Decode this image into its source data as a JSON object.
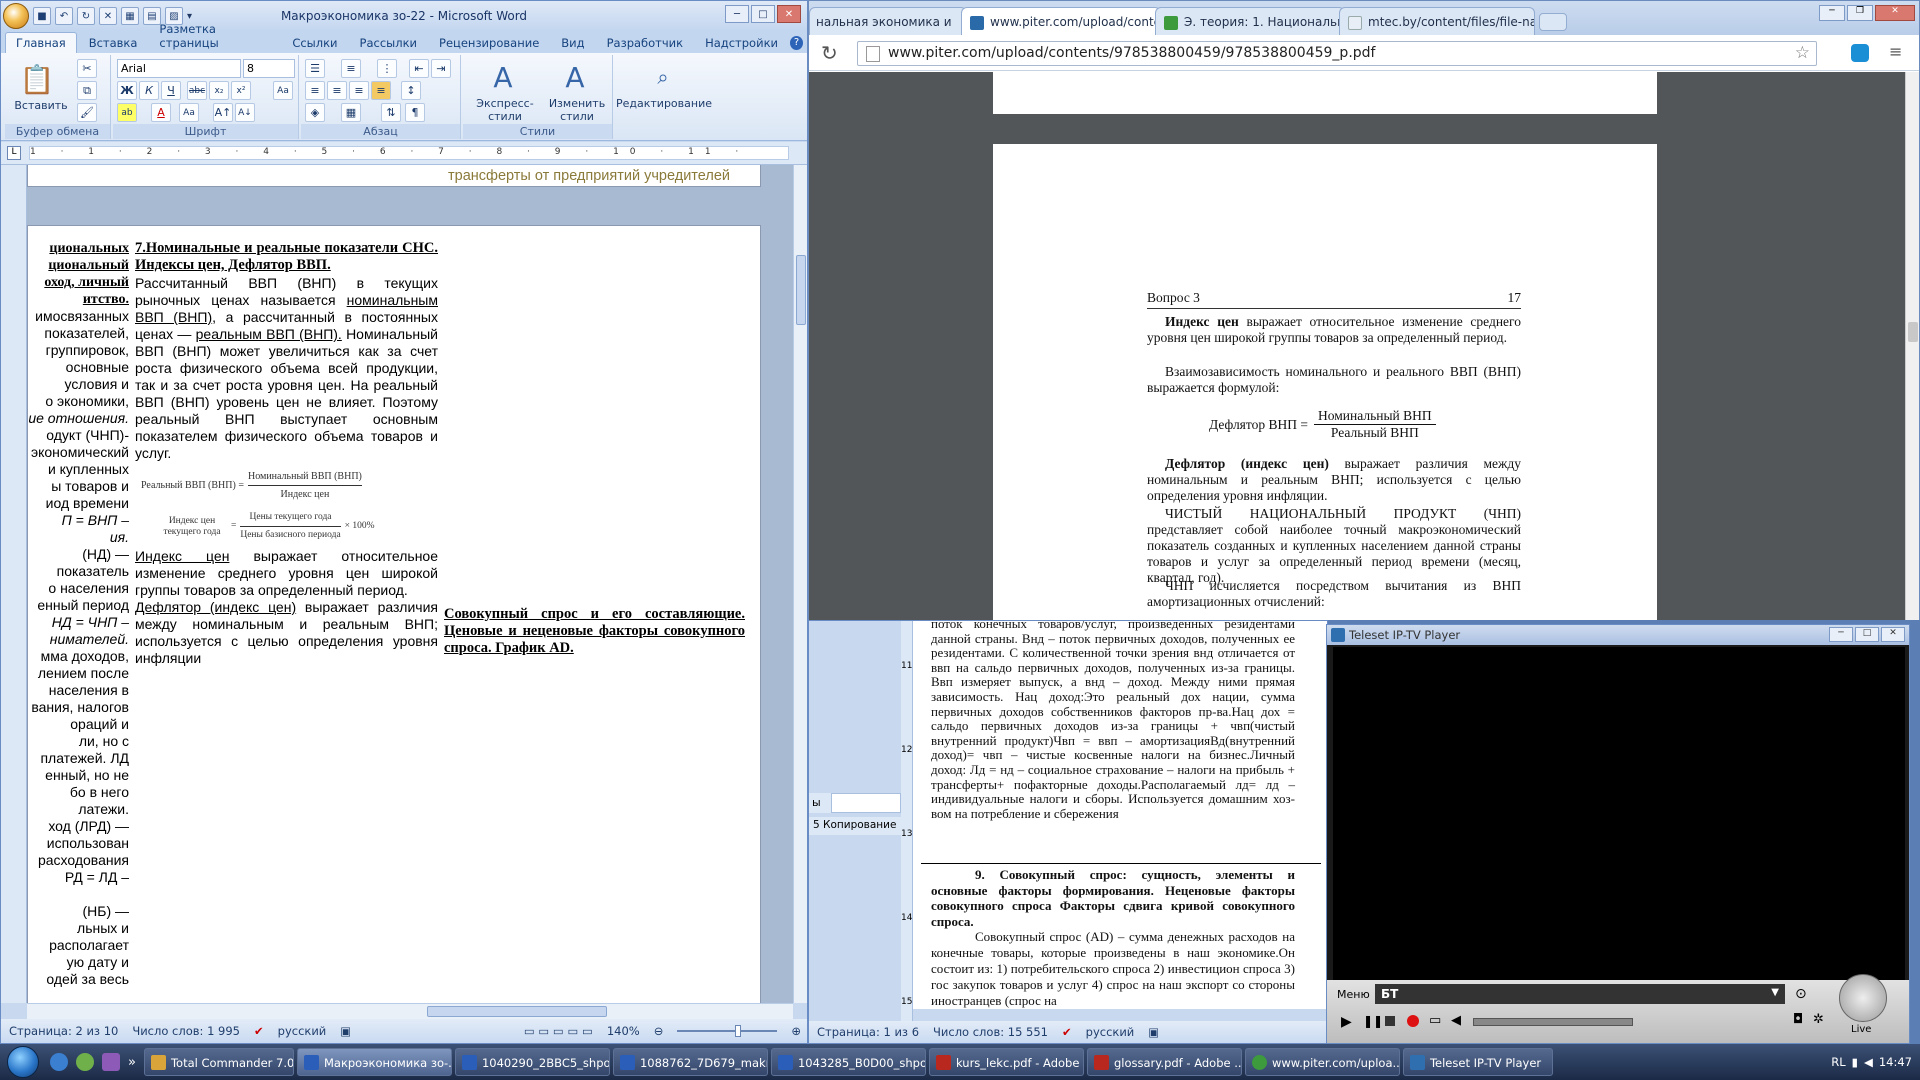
{
  "word": {
    "title": "Макроэкономика зо-22 - Microsoft Word",
    "tabs": [
      "Главная",
      "Вставка",
      "Разметка страницы",
      "Ссылки",
      "Рассылки",
      "Рецензирование",
      "Вид",
      "Разработчик",
      "Надстройки"
    ],
    "font_name": "Arial",
    "font_size": "8",
    "buttons": {
      "paste": "Вставить",
      "express_styles": "Экспресс-стили",
      "change_styles": "Изменить стили",
      "editing": "Редактирование"
    },
    "groups": [
      "Буфер обмена",
      "Шрифт",
      "Абзац",
      "Стили"
    ],
    "ruler": "1 · 1 · 2 · 3 · 4 · 5 · 6 · 7 · 8 · 9 · 10 · 11 ·",
    "prev_page_text": "трансферты от предприятий учредителей",
    "left_col": [
      "циональных",
      "циональный",
      "оход, личный",
      "итство.",
      "имосвязанных",
      "показателей,",
      "группировок,",
      "основные",
      "условия и",
      "о экономики,",
      "ие отношения.",
      "одукт (ЧНП)-",
      "экономический",
      "и купленных",
      "ы товаров и",
      "иод времени",
      "П = ВНП –",
      "ия.",
      "(НД) —",
      "показатель",
      "о населения",
      "енный период",
      "НД = ЧНП –",
      "нимателей.",
      "мма доходов,",
      "лением после",
      "населения в",
      "вания, налогов",
      "ораций и",
      "ли, но с",
      "платежей. ЛД",
      "енный, но не",
      "бо в него",
      "латежи.",
      "ход (ЛРД) —",
      "использован",
      "расходования",
      "РД = ЛД –",
      "",
      "(НБ) —",
      "льных и",
      "располагает",
      "ую дату и",
      "одей за весь"
    ],
    "mid_heading": "7.Номинальные и реальные показатели СНС. Индексы цен, Дефлятор ВВП.",
    "mid_p1": "Рассчитанный ВВП (ВНП) в текущих рыночных ценах называется ",
    "mid_p1_u": "номинальным ВВП (ВНП)",
    "mid_p2": ", а рассчитанный в постоянных ценах — ",
    "mid_p2_u": "реальным ВВП (ВНП).",
    "mid_p3": " Номинальный ВВП (ВНП) может увеличиться как за счет роста физического объема всей продукции, так и за счет роста уровня цен. На реальный ВВП (ВНП) уровень цен не влияет. Поэтому реальный ВНП выступает основным показателем физического объема товаров и услуг.",
    "formula1_left": "Реальный ВВП (ВНП) =",
    "formula1_num": "Номинальный ВВП (ВНП)",
    "formula1_den": "Индекс цен",
    "formula2_left": "Индекс цен текущего года",
    "formula2_num": "Цены текущего года",
    "formula2_den": "Цены базисного периода",
    "formula2_mult": "× 100%",
    "mid_p4_u": "Индекс цен",
    "mid_p4": " выражает относительное изменение среднего уровня цен широкой группы товаров за определенный период.",
    "mid_p5_u": "Дефлятор (индекс цен)",
    "mid_p5": " выражает различия между номинальным и реальным ВНП; используется с целью определения уровня инфляции",
    "right_heading": "Совокупный спрос и его составляющие. Ценовые и неценовые факторы совокупного спроса. График AD.",
    "status": {
      "page": "Страница: 2 из 10",
      "words": "Число слов: 1 995",
      "lang": "русский",
      "zoom": "140%"
    }
  },
  "chrome": {
    "tabs": [
      {
        "label": "нальная экономика и"
      },
      {
        "label": "www.piter.com/upload/conte"
      },
      {
        "label": "Э. теория: 1. Национальна"
      },
      {
        "label": "mtec.by/content/files/file-na"
      }
    ],
    "url": "www.piter.com/upload/contents/978538800459/978538800459_p.pdf",
    "pdf": {
      "header_left": "Вопрос 3",
      "header_right": "17",
      "p1_b": "Индекс цен",
      "p1": " выражает относительное изменение среднего уровня цен широкой группы товаров за определенный период.",
      "p2": "Взаимозависимость номинального и реального ВВП (ВНП) выражается формулой:",
      "formula_left": "Дефлятор ВНП =",
      "formula_num": "Номинальный ВНП",
      "formula_den": "Реальный ВНП",
      "p3_b": "Дефлятор (индекс цен)",
      "p3": " выражает различия между номинальным и реальным ВНП; используется с целью определения уровня инфляции.",
      "p4": "ЧИСТЫЙ НАЦИОНАЛЬНЫЙ ПРОДУКТ (ЧНП) представляет собой наиболее точный макроэкономический показатель созданных и купленных населением данной страны товаров и услуг за определенный период времени (месяц, квартал, год).",
      "p5": "ЧНП исчисляется посредством вычитания из ВНП амортизационных отчислений:"
    }
  },
  "word2": {
    "side_labels": [
      "ы",
      "5 Копирование"
    ],
    "text1": "поток конечных товаров/услуг, произведенных резидентами данной страны. Внд – поток первичных доходов, полученных ее резидентами. С количественной точки зрения внд отличается от ввп на сальдо первичных доходов, полученных из-за границы. Ввп измеряет выпуск, а внд – доход. Между ними прямая зависимость. Нац доход:Это реальный дох нации, сумма первичных доходов собственников факторов пр-ва.Нац дох = сальдо первичных доходов из-за границы + чвп(чистый внутренний продукт)Чвп = ввп – амортизацияВд(внутренний доход)= чвп – чистые косвенные налоги на бизнес.Личный доход: Лд = нд – социальное страхование – налоги на прибыль + трансферты+ пофакторные доходы.Располагаемый лд= лд – индивидуальные налоги и сборы. Используется домашним хоз-вом на потребление и сбережения",
    "heading": "9. Совокупный спрос: сущность, элементы и основные факторы формирования. Неценовые факторы совокупного спроса Факторы сдвига кривой совокупного спроса.",
    "text2": "Совокупный спрос (AD) – сумма денежных расходов на конечные товары, которые произведены в наш экономике.Он состоит из: 1) потребительского спроса 2) инвестицион спроса 3) гос закупок товаров и услуг 4) спрос на наш экспорт со стороны иностранцев (спрос на",
    "ruler_nums": [
      "11",
      "12",
      "13",
      "14",
      "15"
    ],
    "status": {
      "page": "Страница: 1 из 6",
      "words": "Число слов: 15 551",
      "lang": "русский"
    }
  },
  "tv": {
    "title": "Teleset IP-TV Player",
    "menu": "Меню",
    "channel": "БТ",
    "live": "Live"
  },
  "taskbar": {
    "items": [
      {
        "label": "Total Commander 7.0...",
        "color": "#d9a43a"
      },
      {
        "label": "Макроэкономика зо-...",
        "color": "#2b5eb8"
      },
      {
        "label": "1040290_2BBC5_shpo...",
        "color": "#2b5eb8"
      },
      {
        "label": "1088762_7D679_makr...",
        "color": "#2b5eb8"
      },
      {
        "label": "1043285_B0D00_shpo...",
        "color": "#2b5eb8"
      },
      {
        "label": "kurs_lekc.pdf - Adobe ...",
        "color": "#b8281f"
      },
      {
        "label": "glossary.pdf - Adobe ...",
        "color": "#b8281f"
      },
      {
        "label": "www.piter.com/uploa...",
        "color": "#3d9b3d"
      },
      {
        "label": "Teleset IP-TV Player",
        "color": "#2f6fb0"
      }
    ],
    "lang": "RL",
    "clock": "14:47"
  },
  "colors": {
    "ribbon_blue": "#c3d6ef",
    "taskbar": "#1b2a46",
    "pdf_bg": "#525659"
  }
}
